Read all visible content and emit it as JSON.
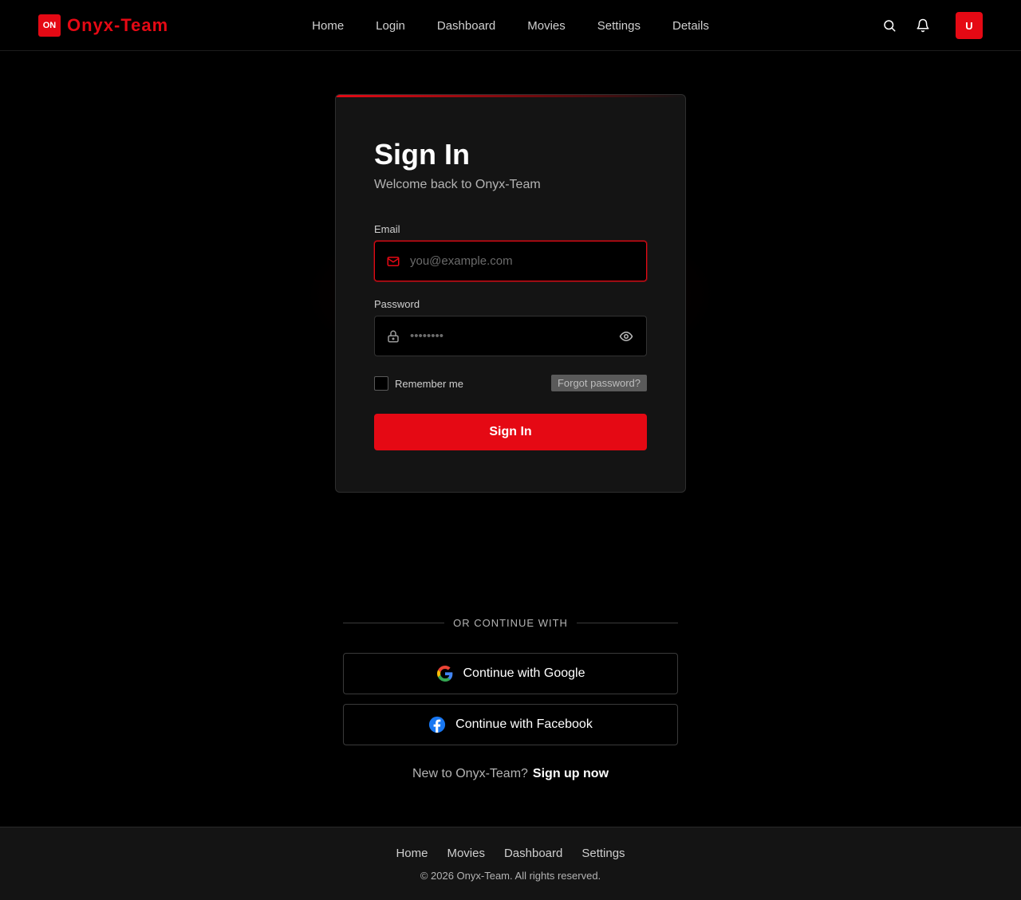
{
  "brand": {
    "badge": "ON",
    "name": "Onyx-Team"
  },
  "nav": {
    "links": [
      "Home",
      "Login",
      "Dashboard",
      "Movies",
      "Settings",
      "Details"
    ],
    "icons": [
      "search-icon",
      "bell-icon"
    ],
    "avatar": "U"
  },
  "signin": {
    "title": "Sign In",
    "subtitle": "Welcome back to Onyx-Team",
    "email_label": "Email",
    "email_placeholder": "you@example.com",
    "email_value": "",
    "password_label": "Password",
    "password_placeholder": "••••••••",
    "password_value": "",
    "remember_label": "Remember me",
    "remember_checked": false,
    "forgot_label": "Forgot password?",
    "submit_label": "Sign In"
  },
  "social": {
    "divider": "OR CONTINUE WITH",
    "google_label": "Continue with Google",
    "facebook_label": "Continue with Facebook"
  },
  "signup": {
    "prompt": "New to Onyx-Team?",
    "link": "Sign up now"
  },
  "footer": {
    "links": [
      "Home",
      "Movies",
      "Dashboard",
      "Settings"
    ],
    "copyright": "© 2026 Onyx-Team. All rights reserved."
  },
  "colors": {
    "accent": "#e50914",
    "background": "#000000",
    "card": "#141414"
  }
}
